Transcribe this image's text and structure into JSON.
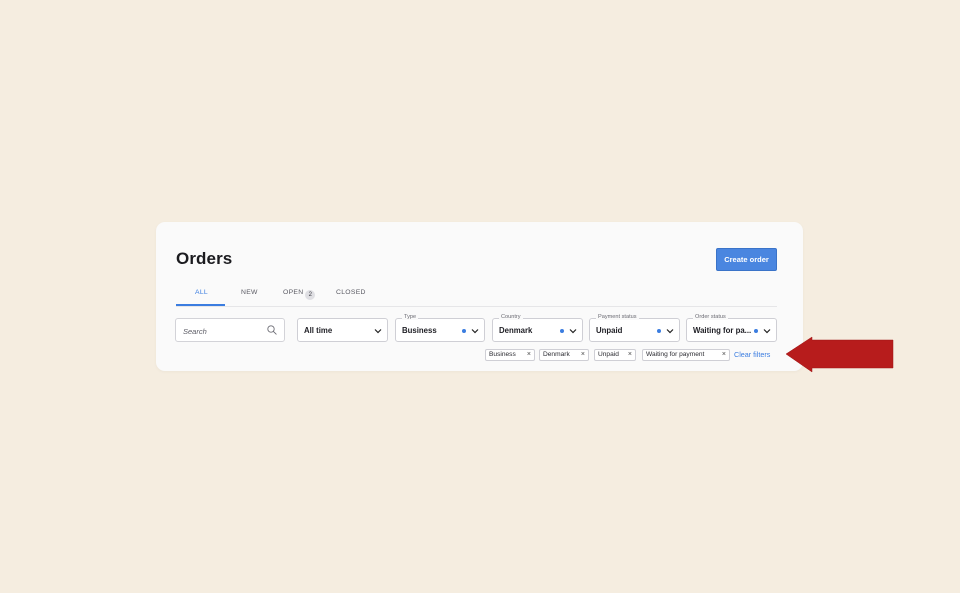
{
  "page": {
    "title": "Orders",
    "create_button": "Create order"
  },
  "tabs": [
    {
      "label": "ALL",
      "active": true
    },
    {
      "label": "NEW",
      "active": false
    },
    {
      "label": "OPEN",
      "active": false,
      "count": "2"
    },
    {
      "label": "CLOSED",
      "active": false
    }
  ],
  "search": {
    "placeholder": "Search",
    "value": ""
  },
  "filters": {
    "time": {
      "value": "All time"
    },
    "type": {
      "label": "Type",
      "value": "Business"
    },
    "country": {
      "label": "Country",
      "value": "Denmark"
    },
    "payment_status": {
      "label": "Payment status",
      "value": "Unpaid"
    },
    "order_status": {
      "label": "Order status",
      "value": "Waiting for pa..."
    }
  },
  "active_filters": [
    {
      "label": "Business"
    },
    {
      "label": "Denmark"
    },
    {
      "label": "Unpaid"
    },
    {
      "label": "Waiting for payment"
    }
  ],
  "clear_filters": "Clear filters",
  "colors": {
    "accent": "#3b7de0",
    "arrow": "#b71c1c",
    "background": "#f5ede0"
  },
  "icons": {
    "search": "search-icon",
    "chevron": "chevron-down-icon",
    "close": "close-icon",
    "arrow": "arrow-left-icon"
  }
}
